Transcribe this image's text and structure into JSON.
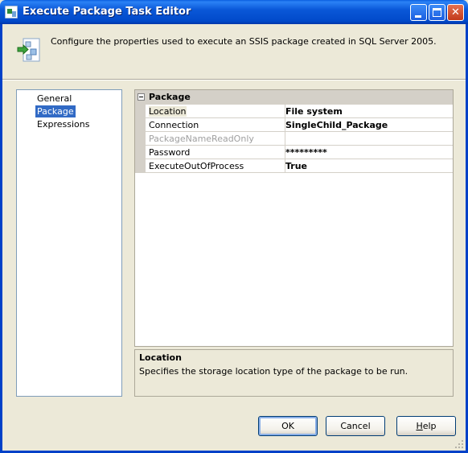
{
  "window": {
    "title": "Execute Package Task Editor"
  },
  "header": {
    "description": "Configure the properties used to execute an SSIS package created in SQL Server 2005."
  },
  "nav": {
    "items": [
      {
        "label": "General",
        "selected": false
      },
      {
        "label": "Package",
        "selected": true
      },
      {
        "label": "Expressions",
        "selected": false
      }
    ]
  },
  "grid": {
    "category": "Package",
    "rows": [
      {
        "name": "Location",
        "value": "File system",
        "readonly": false,
        "selected": true
      },
      {
        "name": "Connection",
        "value": "SingleChild_Package",
        "readonly": false,
        "selected": false
      },
      {
        "name": "PackageNameReadOnly",
        "value": "",
        "readonly": true,
        "selected": false
      },
      {
        "name": "Password",
        "value": "*********",
        "readonly": false,
        "selected": false
      },
      {
        "name": "ExecuteOutOfProcess",
        "value": "True",
        "readonly": false,
        "selected": false
      }
    ]
  },
  "help": {
    "title": "Location",
    "description": "Specifies the storage location type of the package to be run."
  },
  "buttons": {
    "ok": "OK",
    "cancel": "Cancel",
    "help_prefix": "",
    "help_underlined": "H",
    "help_rest": "elp"
  },
  "colors": {
    "titlebar": "#0A58D8",
    "selection": "#316AC5",
    "dialog_bg": "#ECE9D8"
  }
}
